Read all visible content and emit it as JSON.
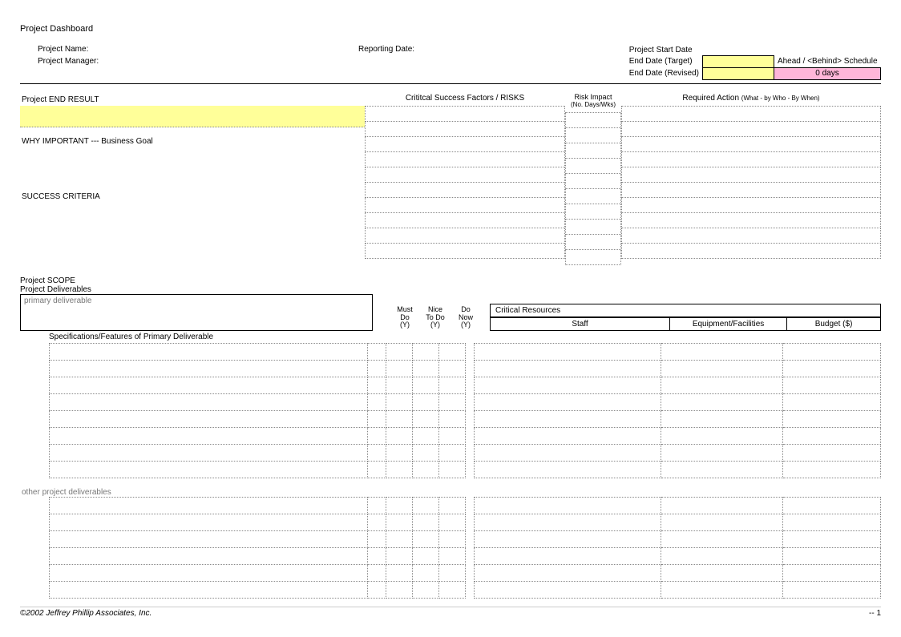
{
  "title": "Project Dashboard",
  "header": {
    "project_name_label": "Project Name:",
    "project_manager_label": "Project Manager:",
    "reporting_date_label": "Reporting Date:",
    "start_date_label": "Project Start Date",
    "end_date_target_label": "End Date (Target)",
    "end_date_revised_label": "End Date (Revised)",
    "schedule_label": "Ahead / <Behind> Schedule",
    "schedule_value": "0 days"
  },
  "top": {
    "end_result_label": "Project END RESULT",
    "why_important_label": "WHY IMPORTANT --- Business Goal",
    "success_criteria_label": "SUCCESS CRITERIA",
    "csf_header": "Crititcal Success Factors / RISKS",
    "risk_impact_header": "Risk Impact",
    "risk_impact_sub": "(No. Days/Wks)",
    "required_action_header": "Required Action",
    "required_action_sub": "(What - by Who - By When)"
  },
  "scope": {
    "scope_label": "Project SCOPE",
    "deliverables_label": "Project Deliverables",
    "primary_placeholder": "primary deliverable",
    "must_do": "Must\nDo\n(Y)",
    "nice_to_do": "Nice\nTo Do\n(Y)",
    "do_now": "Do\nNow\n(Y)",
    "spec_label": "Specifications/Features of Primary Deliverable",
    "crit_res_label": "Critical Resources",
    "staff_label": "Staff",
    "equip_label": "Equipment/Facilities",
    "budget_label": "Budget ($)",
    "other_deliv_label": "other project deliverables"
  },
  "footer": {
    "copyright": "©2002 Jeffrey Phillip Associates, Inc.",
    "page": "-- 1"
  }
}
